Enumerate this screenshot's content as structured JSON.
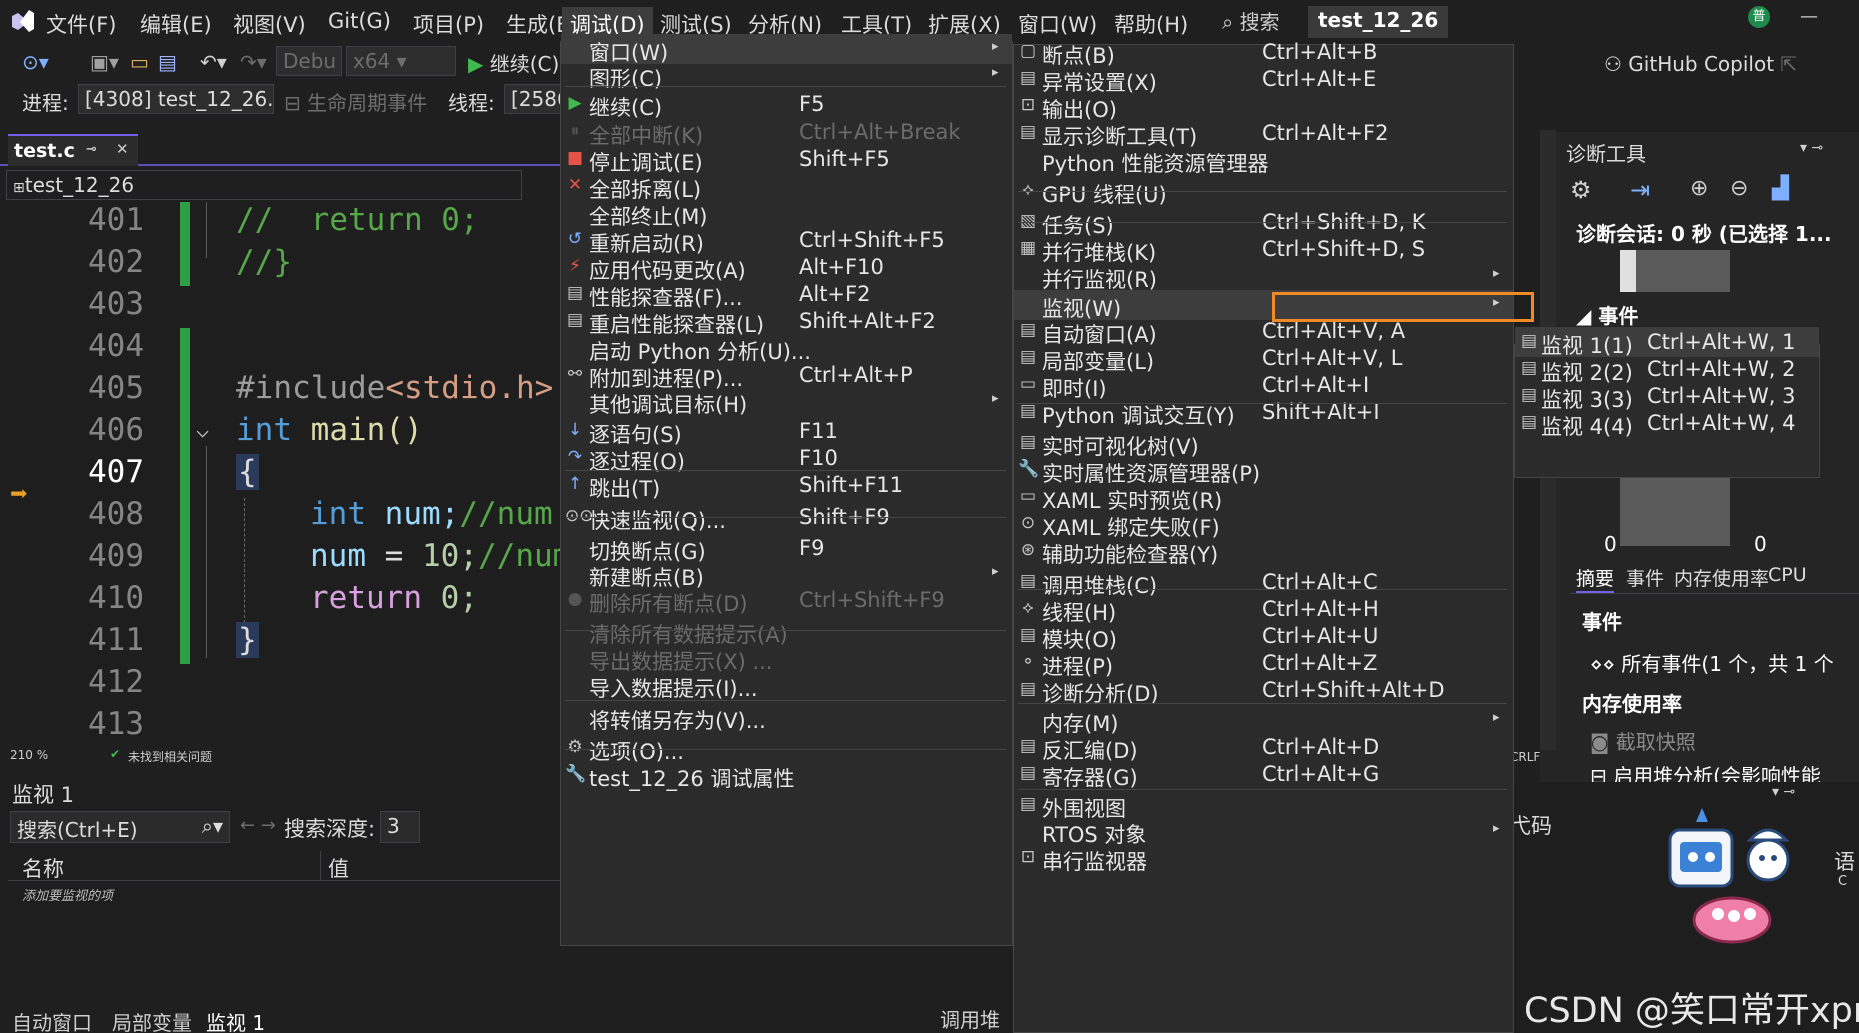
{
  "menubar": {
    "items": [
      "文件(F)",
      "编辑(E)",
      "视图(V)",
      "Git(G)",
      "项目(P)",
      "生成(B)",
      "调试(D)",
      "测试(S)",
      "分析(N)",
      "工具(T)",
      "扩展(X)",
      "窗口(W)",
      "帮助(H)"
    ],
    "search": "搜索",
    "solution_name": "test_12_26",
    "badge": "普"
  },
  "toolbar": {
    "config": "Debu",
    "platform": "x64",
    "continue": "继续(C)",
    "github_copilot": "GitHub Copilot",
    "process_label": "进程:",
    "process_value": "[4308] test_12_26.",
    "lifecycle": "生命周期事件",
    "thread_label": "线程:",
    "thread_value": "[2586"
  },
  "editor": {
    "tab": "test.c",
    "nav_project": "test_12_26",
    "zoom": "210 %",
    "status": "未找到相关问题",
    "line_numbers": [
      "401",
      "402",
      "403",
      "404",
      "405",
      "406",
      "407",
      "408",
      "409",
      "410",
      "411",
      "412",
      "413"
    ],
    "code": {
      "l401a": "//",
      "l401b": "return 0;",
      "l402": "//}",
      "l405a": "#include",
      "l405b": "<stdio.h>",
      "l406a": "int",
      "l406b": "main()",
      "l407": "{",
      "l408a": "int",
      "l408b": "num;",
      "l408c": "//num",
      "l409a": "num",
      "l409b": "=",
      "l409c": "10;",
      "l409d": "//num",
      "l410a": "return",
      "l410b": "0;",
      "l411": "}"
    }
  },
  "watch": {
    "title": "监视 1",
    "search_placeholder": "搜索(Ctrl+E)",
    "depth_label": "搜索深度:",
    "depth_value": "3",
    "col_name": "名称",
    "col_value": "值",
    "add_hint": "添加要监视的项",
    "bottom_tabs": [
      "自动窗口",
      "局部变量",
      "监视 1"
    ],
    "callstack_partial": "调用堆"
  },
  "debug_menu": {
    "items": [
      {
        "label": "窗口(W)",
        "shortcut": "",
        "sub": true,
        "disabled": false
      },
      {
        "label": "图形(C)",
        "shortcut": "",
        "sub": true,
        "disabled": false
      },
      {
        "label": "继续(C)",
        "shortcut": "F5",
        "sub": false,
        "disabled": false
      },
      {
        "label": "全部中断(K)",
        "shortcut": "Ctrl+Alt+Break",
        "sub": false,
        "disabled": true
      },
      {
        "label": "停止调试(E)",
        "shortcut": "Shift+F5",
        "sub": false,
        "disabled": false
      },
      {
        "label": "全部拆离(L)",
        "shortcut": "",
        "sub": false,
        "disabled": false
      },
      {
        "label": "全部终止(M)",
        "shortcut": "",
        "sub": false,
        "disabled": false
      },
      {
        "label": "重新启动(R)",
        "shortcut": "Ctrl+Shift+F5",
        "sub": false,
        "disabled": false
      },
      {
        "label": "应用代码更改(A)",
        "shortcut": "Alt+F10",
        "sub": false,
        "disabled": false
      },
      {
        "label": "性能探查器(F)...",
        "shortcut": "Alt+F2",
        "sub": false,
        "disabled": false
      },
      {
        "label": "重启性能探查器(L)",
        "shortcut": "Shift+Alt+F2",
        "sub": false,
        "disabled": false
      },
      {
        "label": "启动 Python 分析(U)...",
        "shortcut": "",
        "sub": false,
        "disabled": false
      },
      {
        "label": "附加到进程(P)...",
        "shortcut": "Ctrl+Alt+P",
        "sub": false,
        "disabled": false
      },
      {
        "label": "其他调试目标(H)",
        "shortcut": "",
        "sub": true,
        "disabled": false
      },
      {
        "label": "逐语句(S)",
        "shortcut": "F11",
        "sub": false,
        "disabled": false
      },
      {
        "label": "逐过程(O)",
        "shortcut": "F10",
        "sub": false,
        "disabled": false
      },
      {
        "label": "跳出(T)",
        "shortcut": "Shift+F11",
        "sub": false,
        "disabled": false
      },
      {
        "label": "快速监视(Q)...",
        "shortcut": "Shift+F9",
        "sub": false,
        "disabled": false
      },
      {
        "label": "切换断点(G)",
        "shortcut": "F9",
        "sub": false,
        "disabled": false
      },
      {
        "label": "新建断点(B)",
        "shortcut": "",
        "sub": true,
        "disabled": false
      },
      {
        "label": "删除所有断点(D)",
        "shortcut": "Ctrl+Shift+F9",
        "sub": false,
        "disabled": true
      },
      {
        "label": "清除所有数据提示(A)",
        "shortcut": "",
        "sub": false,
        "disabled": true
      },
      {
        "label": "导出数据提示(X) ...",
        "shortcut": "",
        "sub": false,
        "disabled": true
      },
      {
        "label": "导入数据提示(I)...",
        "shortcut": "",
        "sub": false,
        "disabled": false
      },
      {
        "label": "将转储另存为(V)...",
        "shortcut": "",
        "sub": false,
        "disabled": false
      },
      {
        "label": "选项(O)...",
        "shortcut": "",
        "sub": false,
        "disabled": false
      },
      {
        "label": "test_12_26 调试属性",
        "shortcut": "",
        "sub": false,
        "disabled": false
      }
    ]
  },
  "window_menu": {
    "items": [
      {
        "label": "断点(B)",
        "shortcut": "Ctrl+Alt+B",
        "sub": false
      },
      {
        "label": "异常设置(X)",
        "shortcut": "Ctrl+Alt+E",
        "sub": false
      },
      {
        "label": "输出(O)",
        "shortcut": "",
        "sub": false
      },
      {
        "label": "显示诊断工具(T)",
        "shortcut": "Ctrl+Alt+F2",
        "sub": false
      },
      {
        "label": "Python 性能资源管理器",
        "shortcut": "",
        "sub": false
      },
      {
        "label": "GPU 线程(U)",
        "shortcut": "",
        "sub": false
      },
      {
        "label": "任务(S)",
        "shortcut": "Ctrl+Shift+D, K",
        "sub": false
      },
      {
        "label": "并行堆栈(K)",
        "shortcut": "Ctrl+Shift+D, S",
        "sub": false
      },
      {
        "label": "并行监视(R)",
        "shortcut": "",
        "sub": true
      },
      {
        "label": "监视(W)",
        "shortcut": "",
        "sub": true
      },
      {
        "label": "自动窗口(A)",
        "shortcut": "Ctrl+Alt+V, A",
        "sub": false
      },
      {
        "label": "局部变量(L)",
        "shortcut": "Ctrl+Alt+V, L",
        "sub": false
      },
      {
        "label": "即时(I)",
        "shortcut": "Ctrl+Alt+I",
        "sub": false
      },
      {
        "label": "Python 调试交互(Y)",
        "shortcut": "Shift+Alt+I",
        "sub": false
      },
      {
        "label": "实时可视化树(V)",
        "shortcut": "",
        "sub": false
      },
      {
        "label": "实时属性资源管理器(P)",
        "shortcut": "",
        "sub": false
      },
      {
        "label": "XAML 实时预览(R)",
        "shortcut": "",
        "sub": false
      },
      {
        "label": "XAML 绑定失败(F)",
        "shortcut": "",
        "sub": false
      },
      {
        "label": "辅助功能检查器(Y)",
        "shortcut": "",
        "sub": false
      },
      {
        "label": "调用堆栈(C)",
        "shortcut": "Ctrl+Alt+C",
        "sub": false
      },
      {
        "label": "线程(H)",
        "shortcut": "Ctrl+Alt+H",
        "sub": false
      },
      {
        "label": "模块(O)",
        "shortcut": "Ctrl+Alt+U",
        "sub": false
      },
      {
        "label": "进程(P)",
        "shortcut": "Ctrl+Alt+Z",
        "sub": false
      },
      {
        "label": "诊断分析(D)",
        "shortcut": "Ctrl+Shift+Alt+D",
        "sub": false
      },
      {
        "label": "内存(M)",
        "shortcut": "",
        "sub": true
      },
      {
        "label": "反汇编(D)",
        "shortcut": "Ctrl+Alt+D",
        "sub": false
      },
      {
        "label": "寄存器(G)",
        "shortcut": "Ctrl+Alt+G",
        "sub": false
      },
      {
        "label": "外围视图",
        "shortcut": "",
        "sub": false
      },
      {
        "label": "RTOS 对象",
        "shortcut": "",
        "sub": true
      },
      {
        "label": "串行监视器",
        "shortcut": "",
        "sub": false
      }
    ]
  },
  "watch_menu": {
    "items": [
      {
        "label": "监视 1(1)",
        "shortcut": "Ctrl+Alt+W, 1"
      },
      {
        "label": "监视 2(2)",
        "shortcut": "Ctrl+Alt+W, 2"
      },
      {
        "label": "监视 3(3)",
        "shortcut": "Ctrl+Alt+W, 3"
      },
      {
        "label": "监视 4(4)",
        "shortcut": "Ctrl+Alt+W, 4"
      }
    ]
  },
  "diag": {
    "title": "诊断工具",
    "session": "诊断会话: 0 秒 (已选择 1...",
    "events_header": "事件",
    "zero_left": "0",
    "zero_right": "0",
    "tabs": [
      "摘要",
      "事件",
      "内存使用率",
      "CPU"
    ],
    "events_section": "事件",
    "all_events": "所有事件(1 个，共 1 个",
    "memory_section": "内存使用率",
    "snapshot": "截取快照",
    "heap_profiling": "启用堆分析(会影响性能",
    "crlf": "CRLF",
    "code_partial": "弋码",
    "lang_partial": "语",
    "c_partial": "C"
  },
  "watermark": "CSDN @笑口常开xpr"
}
